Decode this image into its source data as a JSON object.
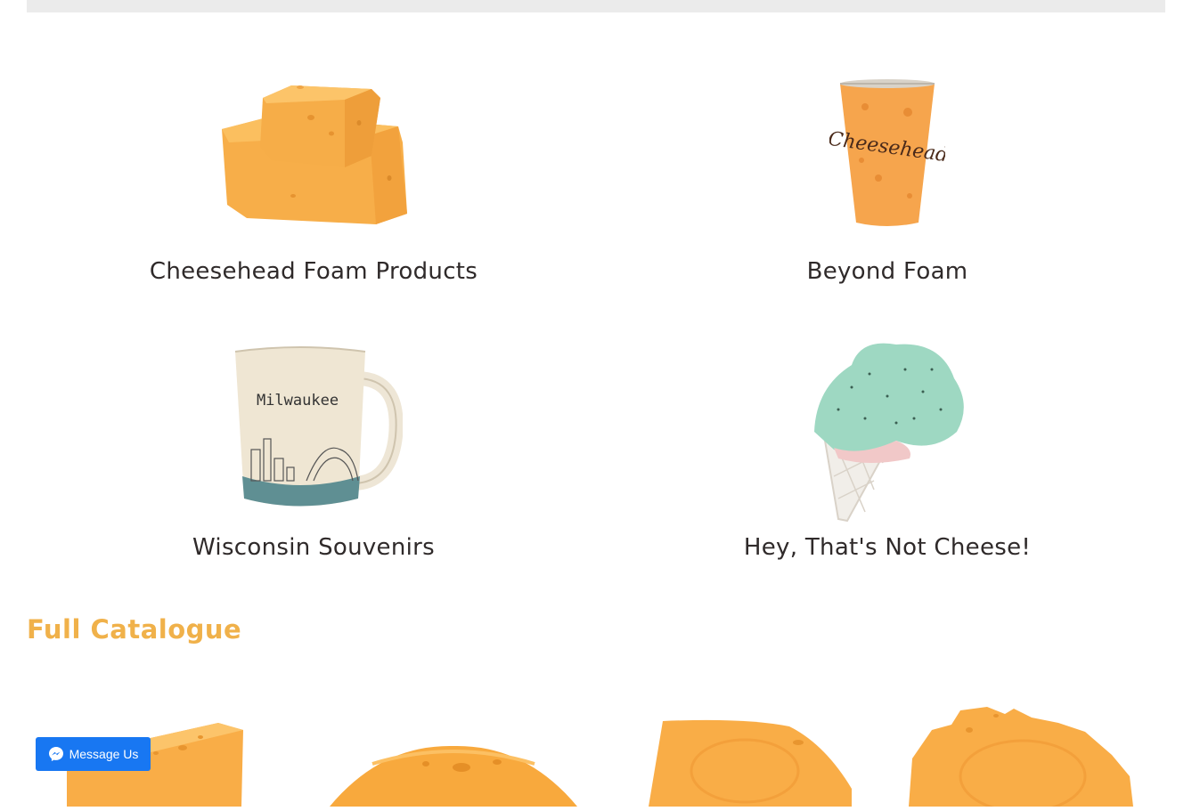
{
  "categories": [
    {
      "label": "Cheesehead Foam Products",
      "icon": "cheese-blocks-image"
    },
    {
      "label": "Beyond Foam",
      "icon": "cheesehead-cup-image"
    },
    {
      "label": "Wisconsin Souvenirs",
      "icon": "milwaukee-mug-image"
    },
    {
      "label": "Hey, That's Not Cheese!",
      "icon": "ice-cream-cone-image"
    }
  ],
  "mug_text": "Milwaukee",
  "cup_text": "Cheesehead",
  "full_catalogue": {
    "title": "Full Catalogue"
  },
  "products": [
    {
      "icon": "cheese-wedge-image"
    },
    {
      "icon": "cheese-wheel-image"
    },
    {
      "icon": "cheese-slice-image"
    },
    {
      "icon": "wisconsin-cheese-image"
    }
  ],
  "messenger": {
    "label": "Message Us",
    "color": "#1877f2"
  },
  "colors": {
    "accent": "#f0b14a",
    "cheese": "#f9b24d",
    "text": "#2f2a2a"
  }
}
